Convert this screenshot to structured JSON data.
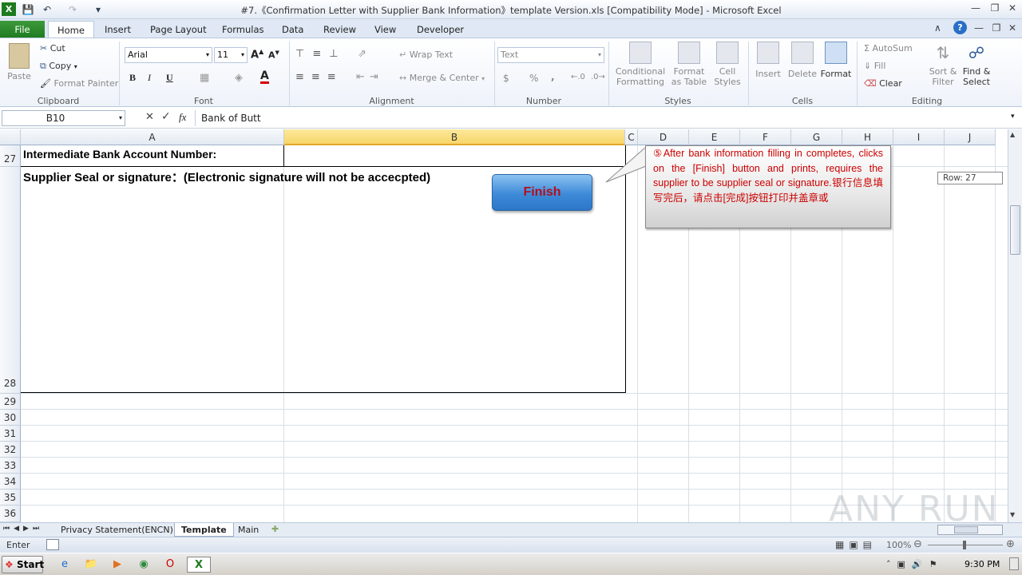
{
  "window": {
    "title": "#7.《Confirmation Letter with Supplier Bank Information》template Version.xls  [Compatibility Mode]  -  Microsoft Excel",
    "app_icon": "excel-icon"
  },
  "ribbon_tabs": [
    "File",
    "Home",
    "Insert",
    "Page Layout",
    "Formulas",
    "Data",
    "Review",
    "View",
    "Developer"
  ],
  "active_tab": "Home",
  "clipboard": {
    "paste": "Paste",
    "cut": "Cut",
    "copy": "Copy",
    "format_painter": "Format Painter",
    "label": "Clipboard"
  },
  "font": {
    "name": "Arial",
    "size": "11",
    "bold": "B",
    "italic": "I",
    "underline": "U",
    "label": "Font"
  },
  "alignment": {
    "wrap_text": "Wrap Text",
    "merge_center": "Merge & Center",
    "label": "Alignment"
  },
  "number": {
    "format": "Text",
    "currency": "$",
    "percent": "%",
    "comma": ",",
    "label": "Number"
  },
  "styles": {
    "conditional": "Conditional Formatting",
    "format_table": "Format as Table",
    "cell_styles": "Cell Styles",
    "label": "Styles"
  },
  "cells": {
    "insert": "Insert",
    "delete": "Delete",
    "format": "Format",
    "label": "Cells"
  },
  "editing": {
    "autosum": "AutoSum",
    "fill": "Fill",
    "clear": "Clear",
    "sort_filter": "Sort & Filter",
    "find_select": "Find & Select",
    "label": "Editing"
  },
  "formula_bar": {
    "name_box": "B10",
    "fx": "fx",
    "value": "Bank of Butt"
  },
  "columns": [
    "A",
    "B",
    "C",
    "D",
    "E",
    "F",
    "G",
    "H",
    "I",
    "J"
  ],
  "rows": [
    "27",
    "28",
    "29",
    "30",
    "31",
    "32",
    "33",
    "34",
    "35",
    "36"
  ],
  "cells_content": {
    "a27": "Intermediate Bank Account Number:",
    "a28": "Supplier Seal or signature：(Electronic signature will not be accecpted)"
  },
  "finish_button": "Finish",
  "callout": "⑤After bank information filling in completes, clicks on the [Finish] button and prints, requires the supplier to be supplier seal or signature.银行信息填写完后，请点击[完成]按钮打印并盖章或",
  "row_tooltip": "Row: 27",
  "sheets": [
    "Privacy Statement(ENCN)",
    "Template",
    "Main"
  ],
  "active_sheet": "Template",
  "status": {
    "mode": "Enter",
    "zoom": "100%"
  },
  "taskbar": {
    "start": "Start",
    "clock": "9:30 PM"
  },
  "watermark": "ANY RUN",
  "colors": {
    "file_tab": "#1e7a1f",
    "selected_col": "#f7d56a",
    "callout_text": "#cc0000",
    "finish_text": "#b0101e"
  }
}
